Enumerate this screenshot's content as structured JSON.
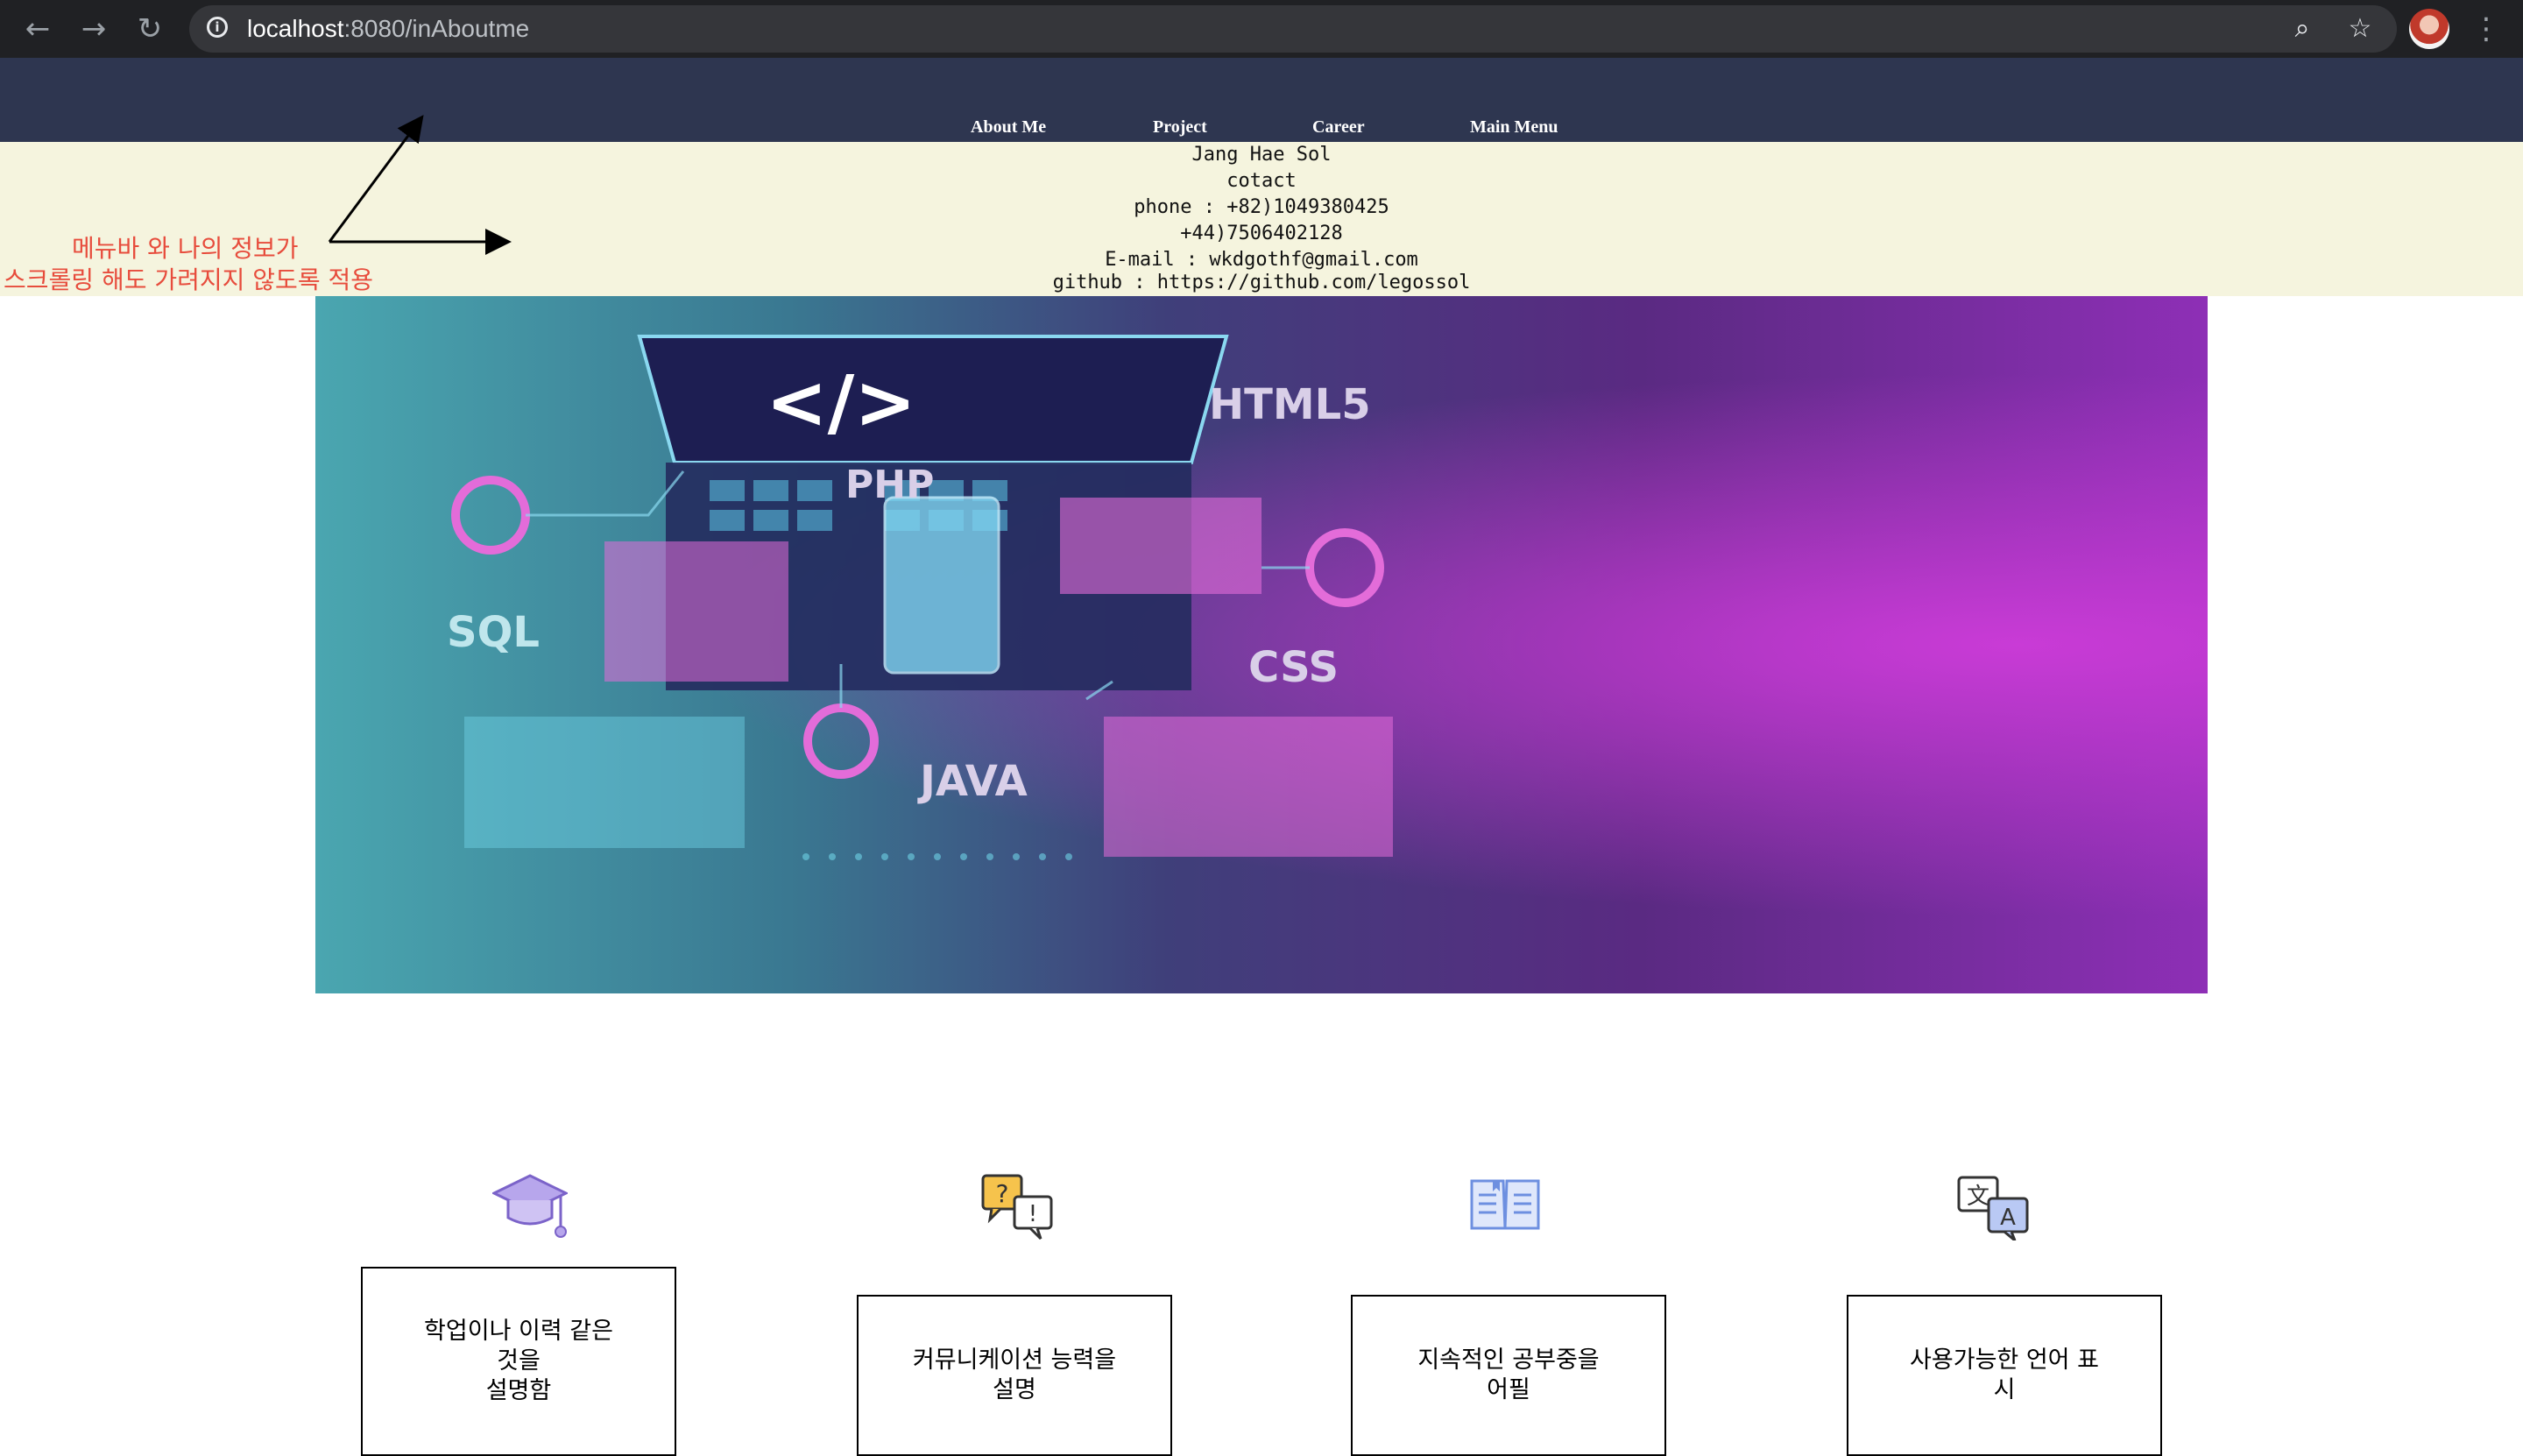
{
  "browser": {
    "url_host": "localhost",
    "url_port_path": ":8080/inAboutme",
    "back_icon": "back-arrow-icon",
    "forward_icon": "forward-arrow-icon",
    "reload_icon": "reload-icon",
    "zoom_icon": "zoom-icon",
    "bookmark_icon": "star-icon"
  },
  "nav": {
    "items": [
      {
        "label": "About Me"
      },
      {
        "label": "Project"
      },
      {
        "label": "Career"
      },
      {
        "label": "Main Menu"
      }
    ]
  },
  "info": {
    "name": "Jang Hae Sol",
    "contact_heading": "cotact",
    "phone_line": "phone : +82)1049380425",
    "phone_line2": "+44)7506402128",
    "email_line": "E-mail : wkdgothf@gmail.com",
    "github_line": "github : https://github.com/legossol"
  },
  "annotation": {
    "line1": "메뉴바 와 나의 정보가",
    "line2": "스크롤링 해도 가려지지 않도록 적용",
    "color": "#e74c3c"
  },
  "hero": {
    "labels": {
      "code": "</>",
      "html5": "HTML5",
      "php": "PHP",
      "sql": "SQL",
      "css": "CSS",
      "java": "JAVA"
    }
  },
  "features": [
    {
      "icon": "graduation-cap-icon",
      "text": "학업이나 이력 같은\n것을\n설명함"
    },
    {
      "icon": "speech-bubbles-icon",
      "text": "커뮤니케이션 능력을\n설명"
    },
    {
      "icon": "open-book-icon",
      "text": "지속적인 공부중을\n어필"
    },
    {
      "icon": "translate-icon",
      "text": "사용가능한 언어 표\n시"
    }
  ]
}
